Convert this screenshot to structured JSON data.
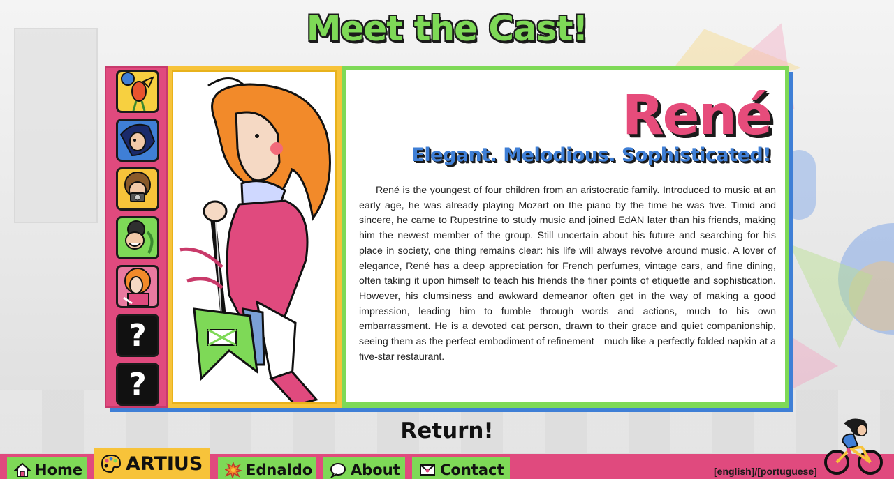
{
  "page": {
    "title": "Meet the Cast!",
    "return_label": "Return!"
  },
  "character": {
    "name": "René",
    "tagline": "Elegant. Melodious. Sophisticated!",
    "bio": "René is the youngest of four children from an aristocratic family. Introduced to music at an early age, he was already playing Mozart on the piano by the time he was five. Timid and sincere, he came to Rupestrine to study music and joined EdAN later than his friends, making him the newest member of the group. Still uncertain about his future and searching for his place in society, one thing remains clear: his life will always revolve around music. A lover of elegance, René has a deep appreciation for French perfumes, vintage cars, and fine dining, often taking it upon himself to teach his friends the finer points of etiquette and sophistication. However, his clumsiness and awkward demeanor often get in the way of making a good impression, leading him to fumble through words and actions, much to his own embarrassment. He is a devoted cat person, drawn to their grace and quiet companionship, seeing them as the perfect embodiment of refinement—much like a perfectly folded napkin at a five-star restaurant."
  },
  "roster": {
    "locked_label": "?"
  },
  "nav": {
    "items": [
      {
        "label": "Home",
        "icon": "house-icon"
      },
      {
        "label": "ARTIUS",
        "icon": "palette-icon"
      },
      {
        "label": "Ednaldo",
        "icon": "explosion-icon"
      },
      {
        "label": "About",
        "icon": "speech-bubble-icon"
      },
      {
        "label": "Contact",
        "icon": "envelope-icon"
      }
    ],
    "lang_english": "[english]",
    "lang_sep": "/",
    "lang_portuguese": "[portuguese]"
  },
  "colors": {
    "pink": "#e04a7e",
    "green": "#7ed957",
    "yellow": "#f7c33a",
    "blue": "#3f7fd6"
  }
}
